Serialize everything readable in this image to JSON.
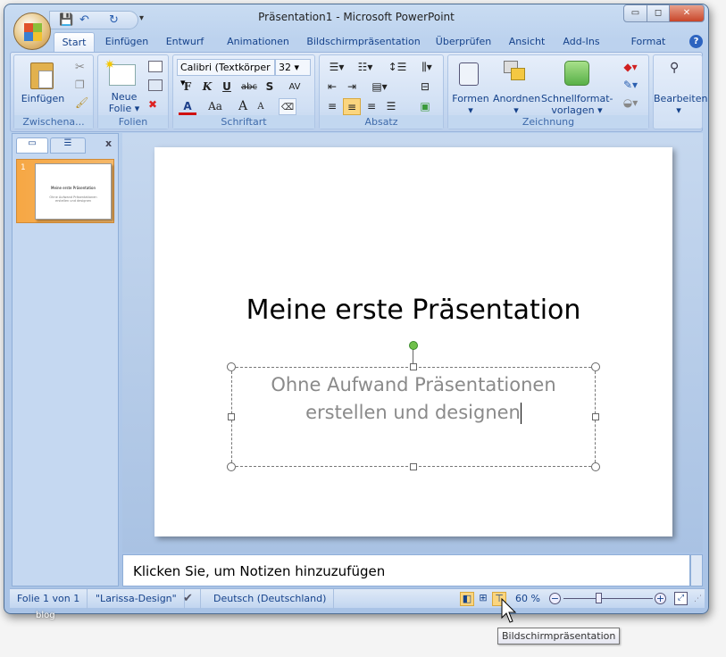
{
  "window": {
    "title": "Präsentation1 - Microsoft PowerPoint",
    "minimize": "▭",
    "maximize": "◻",
    "close": "✕"
  },
  "qat": {
    "save": "💾",
    "undo": "↶",
    "redo": "↻",
    "customize": "▾"
  },
  "tabs": [
    "Start",
    "Einfügen",
    "Entwurf",
    "Animationen",
    "Bildschirmpräsentation",
    "Überprüfen",
    "Ansicht",
    "Add-Ins",
    "Format"
  ],
  "help": "?",
  "ribbon": {
    "clipboard": {
      "label": "Zwischena...",
      "paste": "Einfügen"
    },
    "slides": {
      "label": "Folien",
      "new_slide_line1": "Neue",
      "new_slide_line2": "Folie"
    },
    "font": {
      "label": "Schriftart",
      "font_name": "Calibri (Textkörper",
      "font_size": "32",
      "bold": "F",
      "italic": "K",
      "underline": "U",
      "strike": "abc",
      "shadow": "S",
      "spacing": "AV",
      "color": "A",
      "case": "Aa",
      "grow": "A",
      "shrink": "A"
    },
    "paragraph": {
      "label": "Absatz"
    },
    "drawing": {
      "label": "Zeichnung",
      "shapes": "Formen",
      "arrange": "Anordnen",
      "quickstyles_line1": "Schnellformat-",
      "quickstyles_line2": "vorlagen"
    },
    "editing": {
      "label": "Bearbeiten"
    }
  },
  "pane": {
    "close": "x",
    "slide_number": "1",
    "thumb_title": "Meine erste Präsentation",
    "thumb_sub": "Ohne Aufwand Präsentationen erstellen und designen"
  },
  "slide": {
    "title": "Meine erste Präsentation",
    "subtitle_line1": "Ohne Aufwand Präsentationen",
    "subtitle_line2": "erstellen und designen"
  },
  "notes": {
    "placeholder": "Klicken Sie, um  Notizen hinzuzufügen"
  },
  "status": {
    "slide": "Folie 1 von 1",
    "theme": "\"Larissa-Design\"",
    "language": "Deutsch (Deutschland)",
    "zoom": "60 %",
    "zoom_fraction": 0.5
  },
  "watermark": "blog",
  "tooltip": "Bildschirmpräsentation"
}
